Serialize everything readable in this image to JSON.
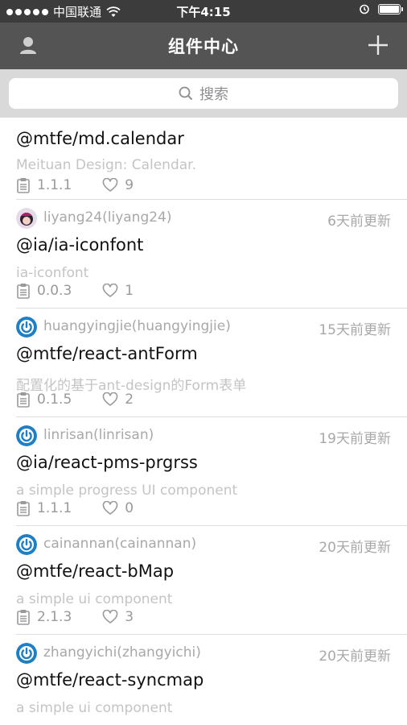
{
  "status_bar": {
    "carrier": "中国联通",
    "time": "下午4:15",
    "battery_level": 1.0
  },
  "nav": {
    "title": "组件中心",
    "left_icon": "user-icon",
    "right_icon": "plus-icon"
  },
  "search": {
    "placeholder": "搜索",
    "icon": "search-icon"
  },
  "packages": [
    {
      "author": "",
      "updated": "",
      "name": "@mtfe/md.calendar",
      "description": "Meituan Design: Calendar.",
      "version": "1.1.1",
      "likes": "9",
      "avatar": "dark"
    },
    {
      "author": "liyang24(liyang24)",
      "updated": "6天前更新",
      "name": "@ia/ia-iconfont",
      "description": "ia-iconfont",
      "version": "0.0.3",
      "likes": "1",
      "avatar": "photo"
    },
    {
      "author": "huangyingjie(huangyingjie)",
      "updated": "15天前更新",
      "name": "@mtfe/react-antForm",
      "description": "配置化的基于ant-design的Form表单",
      "version": "0.1.5",
      "likes": "2",
      "avatar": "power"
    },
    {
      "author": "linrisan(linrisan)",
      "updated": "19天前更新",
      "name": "@ia/react-pms-prgrss",
      "description": "a simple progress UI component",
      "version": "1.1.1",
      "likes": "0",
      "avatar": "power"
    },
    {
      "author": "cainannan(cainannan)",
      "updated": "20天前更新",
      "name": "@mtfe/react-bMap",
      "description": "a simple ui component",
      "version": "2.1.3",
      "likes": "3",
      "avatar": "power"
    },
    {
      "author": "zhangyichi(zhangyichi)",
      "updated": "20天前更新",
      "name": "@mtfe/react-syncmap",
      "description": "a simple ui component",
      "version": "",
      "likes": "",
      "avatar": "power"
    }
  ],
  "colors": {
    "status_bar": "#3c3c3c",
    "nav_bar": "#545454",
    "search_bg": "#d9d9d9",
    "avatar_blue": "#1d7fc4"
  }
}
